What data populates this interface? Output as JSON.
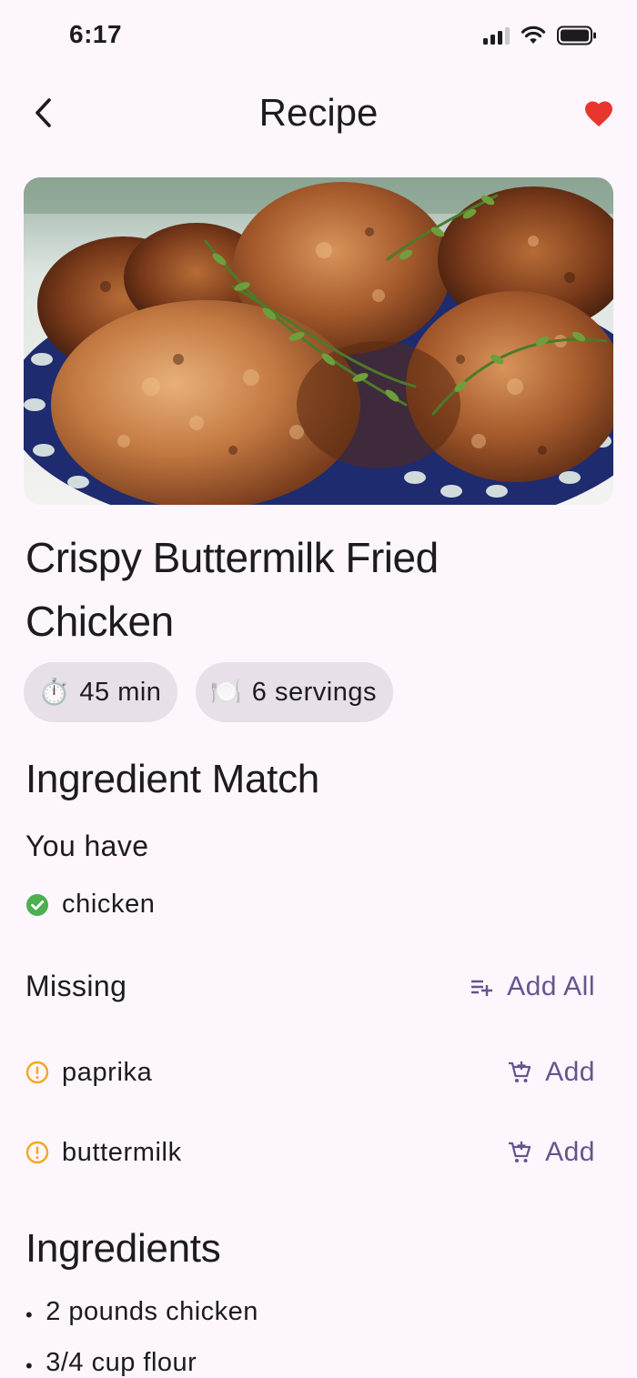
{
  "status_bar": {
    "time": "6:17"
  },
  "app_bar": {
    "title": "Recipe",
    "back_icon": "chevron-left-icon",
    "favorite_icon": "heart-icon",
    "favorite_color": "#e8362e"
  },
  "recipe": {
    "title": "Crispy Buttermilk Fried Chicken",
    "chips": [
      {
        "icon": "stopwatch-icon",
        "emoji": "⏱️",
        "label": "45 min"
      },
      {
        "icon": "plate-icon",
        "emoji": "🍽️",
        "label": "6 servings"
      }
    ]
  },
  "ingredient_match": {
    "heading": "Ingredient Match",
    "have_heading": "You have",
    "have": [
      {
        "name": "chicken",
        "icon": "check-circle-icon",
        "color": "#4caf50"
      }
    ],
    "missing_heading": "Missing",
    "add_all_label": "Add All",
    "missing": [
      {
        "name": "paprika",
        "icon": "warning-circle-icon",
        "color": "#f5a623",
        "action": "Add"
      },
      {
        "name": "buttermilk",
        "icon": "warning-circle-icon",
        "color": "#f5a623",
        "action": "Add"
      }
    ]
  },
  "ingredients": {
    "heading": "Ingredients",
    "items": [
      "2 pounds chicken",
      "3/4 cup flour"
    ]
  },
  "colors": {
    "accent": "#65558f",
    "background": "#fdf7fd",
    "chip": "#e7e0e8"
  }
}
